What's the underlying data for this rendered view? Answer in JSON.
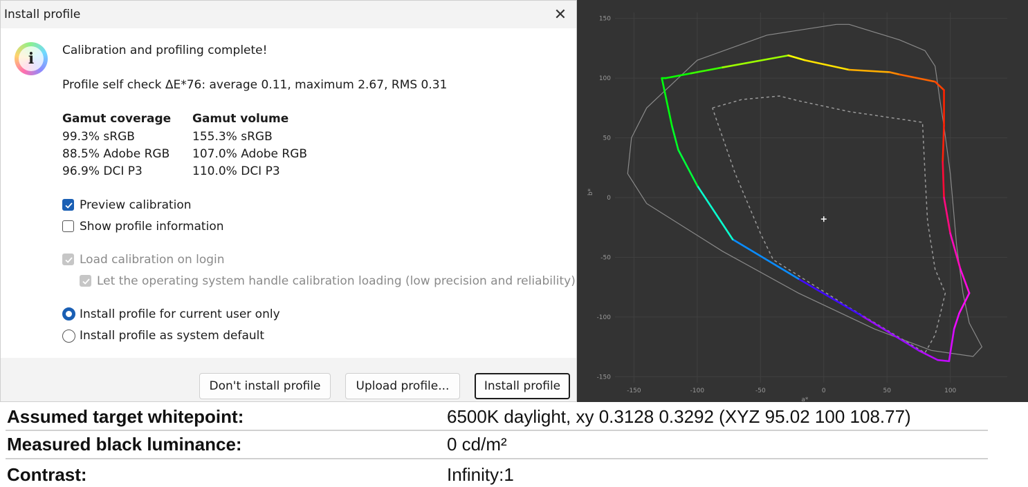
{
  "dialog": {
    "title": "Install profile",
    "close_glyph": "✕",
    "icon": "info-icon",
    "heading": "Calibration and profiling complete!",
    "self_check": "Profile self check ΔE*76: average 0.11, maximum 2.67, RMS 0.31",
    "gamut": {
      "coverage_header": "Gamut coverage",
      "volume_header": "Gamut volume",
      "coverage": [
        "99.3% sRGB",
        "88.5% Adobe RGB",
        "96.9% DCI P3"
      ],
      "volume": [
        "155.3% sRGB",
        "107.0% Adobe RGB",
        "110.0% DCI P3"
      ]
    },
    "options": {
      "preview_calibration": {
        "label": "Preview calibration",
        "checked": true
      },
      "show_profile_info": {
        "label": "Show profile information",
        "checked": false
      },
      "load_on_login": {
        "label": "Load calibration on login",
        "checked": true,
        "disabled": true
      },
      "os_handle": {
        "label": "Let the operating system handle calibration loading (low precision and reliability)",
        "checked": true,
        "disabled": true
      },
      "current_user": {
        "label": "Install profile for current user only",
        "selected": true
      },
      "system_default": {
        "label": "Install profile as system default",
        "selected": false
      }
    },
    "buttons": {
      "dont_install": "Don't install profile",
      "upload": "Upload profile...",
      "install": "Install profile"
    },
    "accent_color": "#1a5fb4"
  },
  "chart_data": {
    "type": "line",
    "xlabel": "a*",
    "ylabel": "b*",
    "xticks": [
      -150,
      -100,
      -50,
      0,
      50,
      100
    ],
    "yticks": [
      150,
      100,
      50,
      0,
      -50,
      -100,
      -150
    ],
    "xlim": [
      -165,
      145
    ],
    "ylim": [
      -155,
      155
    ],
    "grid": true,
    "background": "#333333",
    "series": [
      {
        "style": "gamut-outline-light",
        "color": "#8a8a8a",
        "points": [
          [
            10,
            145
          ],
          [
            20,
            145
          ],
          [
            60,
            132
          ],
          [
            80,
            123
          ],
          [
            88,
            110
          ],
          [
            90,
            95
          ],
          [
            92,
            80
          ],
          [
            95,
            60
          ],
          [
            100,
            20
          ],
          [
            105,
            -40
          ],
          [
            110,
            -80
          ],
          [
            115,
            -105
          ],
          [
            125,
            -125
          ],
          [
            118,
            -133
          ],
          [
            85,
            -128
          ],
          [
            40,
            -110
          ],
          [
            -20,
            -80
          ],
          [
            -80,
            -45
          ],
          [
            -140,
            -5
          ],
          [
            -155,
            20
          ],
          [
            -152,
            50
          ],
          [
            -140,
            75
          ],
          [
            -100,
            115
          ],
          [
            -45,
            136
          ],
          [
            10,
            145
          ]
        ]
      },
      {
        "style": "display-gamut-spectral",
        "points": [
          [
            -125,
            100
          ],
          [
            -105,
            104
          ],
          [
            -80,
            109
          ],
          [
            -28,
            119
          ],
          [
            -15,
            115
          ],
          [
            20,
            107
          ],
          [
            52,
            105
          ],
          [
            60,
            103
          ],
          [
            88,
            97
          ],
          [
            95,
            90
          ],
          [
            95,
            60
          ],
          [
            94,
            30
          ],
          [
            95,
            0
          ],
          [
            100,
            -30
          ],
          [
            108,
            -60
          ],
          [
            115,
            -80
          ],
          [
            107,
            -97
          ],
          [
            103,
            -110
          ],
          [
            100,
            -130
          ],
          [
            99,
            -137
          ],
          [
            90,
            -136
          ],
          [
            75,
            -128
          ],
          [
            30,
            -99
          ],
          [
            -20,
            -68
          ],
          [
            -72,
            -35
          ],
          [
            -100,
            10
          ],
          [
            -115,
            40
          ],
          [
            -120,
            60
          ],
          [
            -128,
            100
          ],
          [
            -125,
            100
          ]
        ]
      },
      {
        "style": "reference-gamut-dashed",
        "color": "#9a9a9a",
        "points": [
          [
            -88,
            75
          ],
          [
            -65,
            82
          ],
          [
            -35,
            85
          ],
          [
            -20,
            81
          ],
          [
            20,
            72
          ],
          [
            78,
            63
          ],
          [
            80,
            20
          ],
          [
            82,
            -20
          ],
          [
            88,
            -60
          ],
          [
            96,
            -80
          ],
          [
            92,
            -98
          ],
          [
            88,
            -115
          ],
          [
            80,
            -130
          ],
          [
            20,
            -92
          ],
          [
            -40,
            -52
          ],
          [
            -50,
            -30
          ],
          [
            -70,
            20
          ],
          [
            -88,
            75
          ]
        ]
      }
    ],
    "whitepoint_marker": [
      0,
      -18
    ]
  },
  "summary": {
    "rows": [
      {
        "label": "Assumed target whitepoint:",
        "value": "6500K daylight, xy 0.3128 0.3292 (XYZ 95.02 100 108.77)"
      },
      {
        "label": "Measured black luminance:",
        "value": "0 cd/m²"
      },
      {
        "label": "Contrast:",
        "value": "Infinity:1"
      }
    ]
  }
}
